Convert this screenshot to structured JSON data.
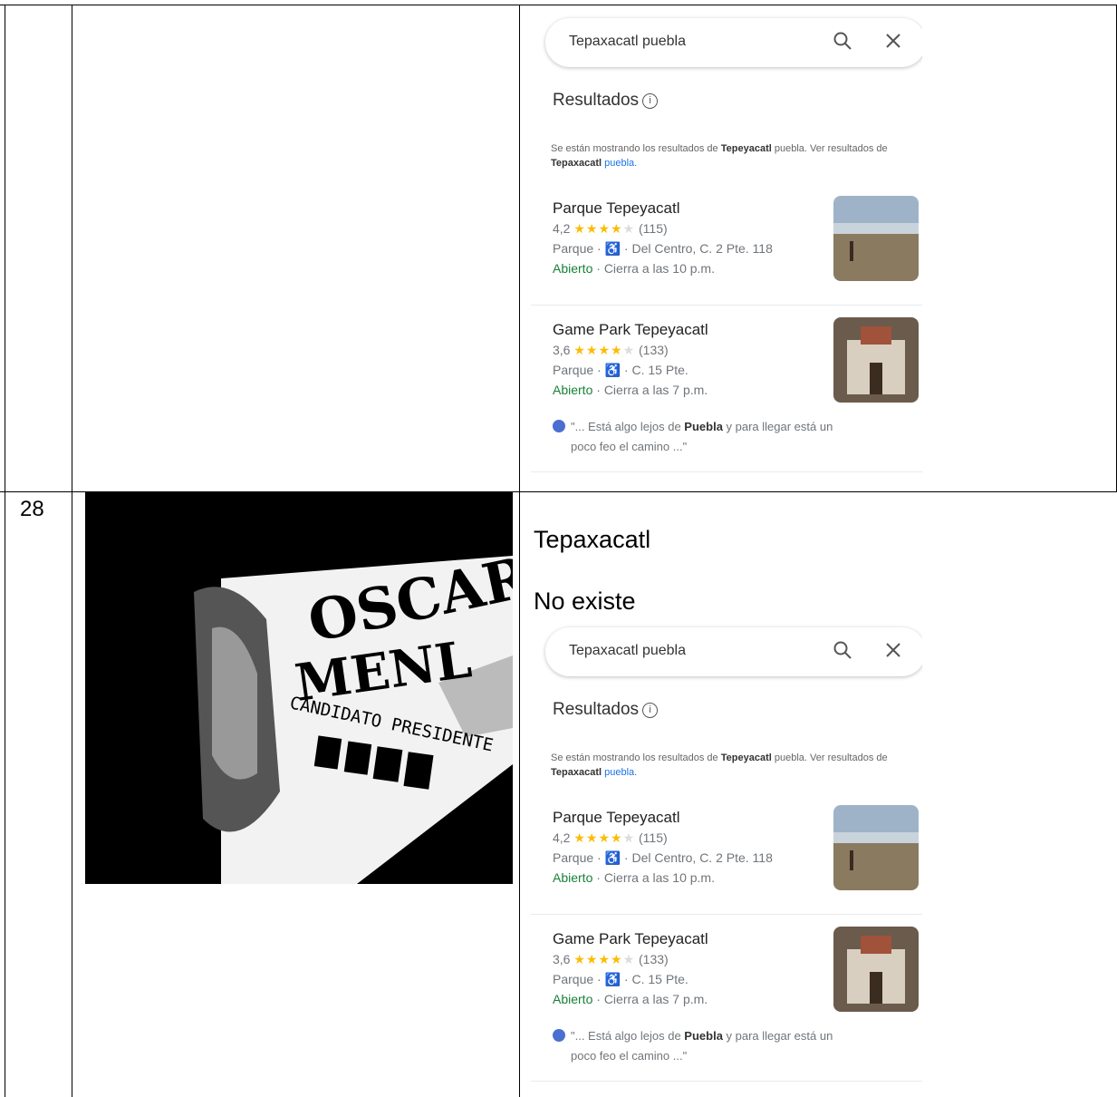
{
  "row_number": "28",
  "cell_title": "Tepaxacatl",
  "cell_status": "No existe",
  "photo_text": {
    "line1": "OSCAR",
    "line2": "MENL",
    "line3": "CANDIDATO PRESIDENTE"
  },
  "maps": {
    "search_query": "Tepaxacatl puebla",
    "results_heading": "Resultados",
    "notice_prefix": "Se están mostrando los resultados de ",
    "notice_bold": "Tepeyacatl",
    "notice_mid": " puebla. Ver resultados de ",
    "notice_link_bold": "Tepaxacatl",
    "notice_link_rest": " puebla.",
    "results": [
      {
        "name": "Parque Tepeyacatl",
        "rating": "4,2",
        "stars_on": "★★★★",
        "stars_off": "★",
        "reviews": "(115)",
        "category": "Parque",
        "address": "Del Centro, C. 2 Pte. 118",
        "open": "Abierto",
        "closes": "Cierra a las 10 p.m."
      },
      {
        "name": "Game Park Tepeyacatl",
        "rating": "3,6",
        "stars_on": "★★★★",
        "stars_off": "★",
        "reviews": "(133)",
        "category": "Parque",
        "address": "C. 15 Pte.",
        "open": "Abierto",
        "closes": "Cierra a las 7 p.m."
      }
    ],
    "review_prefix": "\"... Está algo lejos de ",
    "review_bold": "Puebla",
    "review_rest": " y para llegar está un",
    "review_line2": "poco feo el camino ...\""
  }
}
